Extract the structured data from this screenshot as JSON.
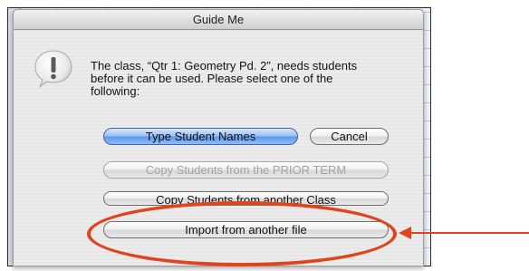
{
  "dialog": {
    "title": "Guide Me",
    "message": "The class, “Qtr 1: Geometry Pd. 2”, needs students before it can be used. Please select one of the following:",
    "icon": "alert-exclamation-icon"
  },
  "buttons": {
    "type_names": "Type Student Names",
    "cancel": "Cancel",
    "copy_prior": "Copy Students from the PRIOR TERM",
    "copy_class": "Copy Students from another Class",
    "import_file": "Import from another file"
  },
  "annotation": {
    "color": "#e0441e",
    "target": "Import from another file"
  },
  "colors": {
    "default_button": "#5d9aec",
    "disabled_text": "#a3a3a3",
    "window_grid": "#b9c7dd"
  }
}
